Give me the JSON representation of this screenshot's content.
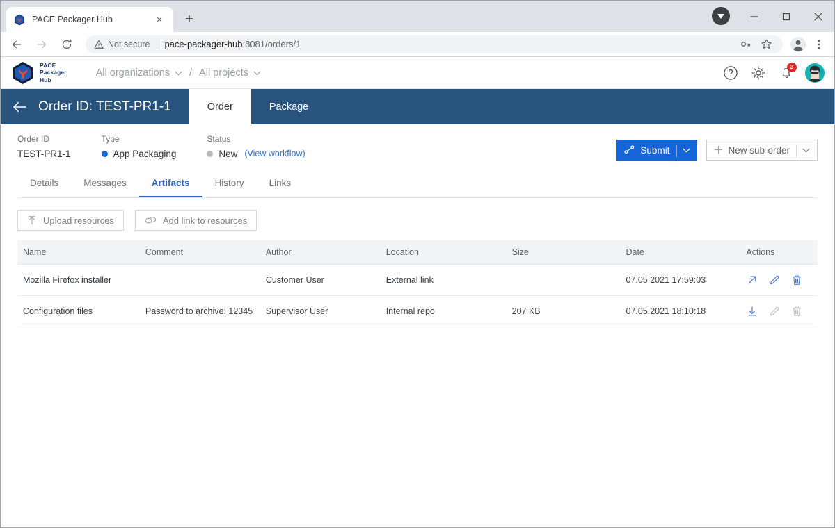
{
  "browser": {
    "tab_title": "PACE Packager Hub",
    "tab_favicon": "pace-cube-icon",
    "close_tab_label": "×",
    "new_tab_label": "+",
    "back_label": "←",
    "forward_label": "→",
    "reload_label": "↻",
    "security_text": "Not secure",
    "url_host": "pace-packager-hub",
    "url_rest": ":8081/orders/1",
    "window_minimize": "–",
    "window_maximize": "□",
    "window_close": "✕"
  },
  "app_header": {
    "logo_line1": "PACE",
    "logo_line2": "Packager",
    "logo_line3": "Hub",
    "breadcrumbs": [
      {
        "label": "All organizations"
      },
      {
        "label": "All projects"
      }
    ],
    "breadcrumb_separator": "/",
    "help_icon": "help-circle-icon",
    "settings_icon": "gear-icon",
    "notifications_icon": "bell-icon",
    "notifications_count": "3",
    "avatar_icon": "user-avatar"
  },
  "order_bar": {
    "back_icon": "arrow-left-icon",
    "title": "Order ID: TEST-PR1-1",
    "tabs": [
      {
        "label": "Order",
        "active": true
      },
      {
        "label": "Package",
        "active": false
      }
    ]
  },
  "meta": {
    "fields": [
      {
        "label": "Order ID",
        "value": "TEST-PR1-1",
        "dot": null
      },
      {
        "label": "Type",
        "value": "App Packaging",
        "dot": "#1565d8"
      },
      {
        "label": "Status",
        "value": "New",
        "dot": "#b7bbbf"
      }
    ],
    "workflow_link": "(View workflow)",
    "submit_label": "Submit",
    "submit_icon": "workflow-transition-icon",
    "submit_caret": "∨",
    "new_suborder_label": "New sub-order",
    "new_suborder_icon": "plus-icon",
    "new_suborder_caret": "∨"
  },
  "subtabs": [
    {
      "label": "Details",
      "active": false
    },
    {
      "label": "Messages",
      "active": false
    },
    {
      "label": "Artifacts",
      "active": true
    },
    {
      "label": "History",
      "active": false
    },
    {
      "label": "Links",
      "active": false
    }
  ],
  "resource_toolbar": {
    "upload_label": "Upload resources",
    "upload_icon": "upload-icon",
    "add_link_label": "Add link to resources",
    "add_link_icon": "link-icon"
  },
  "table": {
    "columns": [
      "Name",
      "Comment",
      "Author",
      "Location",
      "Size",
      "Date",
      "Actions"
    ],
    "rows": [
      {
        "name": "Mozilla Firefox installer",
        "comment": "",
        "author": "Customer User",
        "location": "External link",
        "size": "",
        "date": "07.05.2021 17:59:03",
        "actions": [
          {
            "icon": "external-link-icon",
            "disabled": false
          },
          {
            "icon": "edit-pencil-icon",
            "disabled": false
          },
          {
            "icon": "trash-icon",
            "disabled": false
          }
        ]
      },
      {
        "name": "Configuration files",
        "comment": "Password to archive: 12345",
        "author": "Supervisor User",
        "location": "Internal repo",
        "size": "207 KB",
        "date": "07.05.2021 18:10:18",
        "actions": [
          {
            "icon": "download-icon",
            "disabled": false
          },
          {
            "icon": "edit-pencil-icon",
            "disabled": true
          },
          {
            "icon": "trash-icon",
            "disabled": true
          }
        ]
      }
    ]
  },
  "colors": {
    "order_bar_blue": "#27537d",
    "primary_blue": "#1565d8",
    "accent_link": "#2f6fd0",
    "active_tab_blue": "#2b62c6",
    "badge_red": "#e02b2b",
    "logo_navy": "#1f3864",
    "logo_orange": "#ee4d2e"
  }
}
